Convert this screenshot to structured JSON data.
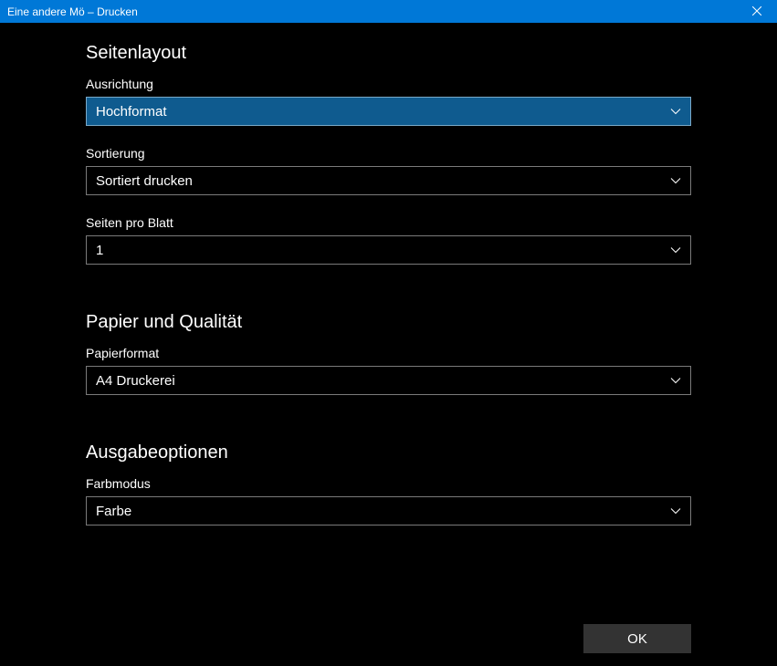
{
  "window": {
    "title": "Eine andere Mö – Drucken"
  },
  "sections": {
    "layout": {
      "title": "Seitenlayout",
      "orientation": {
        "label": "Ausrichtung",
        "value": "Hochformat"
      },
      "sorting": {
        "label": "Sortierung",
        "value": "Sortiert drucken"
      },
      "pagesPerSheet": {
        "label": "Seiten pro Blatt",
        "value": "1"
      }
    },
    "paper": {
      "title": "Papier und Qualität",
      "format": {
        "label": "Papierformat",
        "value": "A4 Druckerei"
      }
    },
    "output": {
      "title": "Ausgabeoptionen",
      "colorMode": {
        "label": "Farbmodus",
        "value": "Farbe"
      }
    }
  },
  "footer": {
    "ok": "OK"
  }
}
